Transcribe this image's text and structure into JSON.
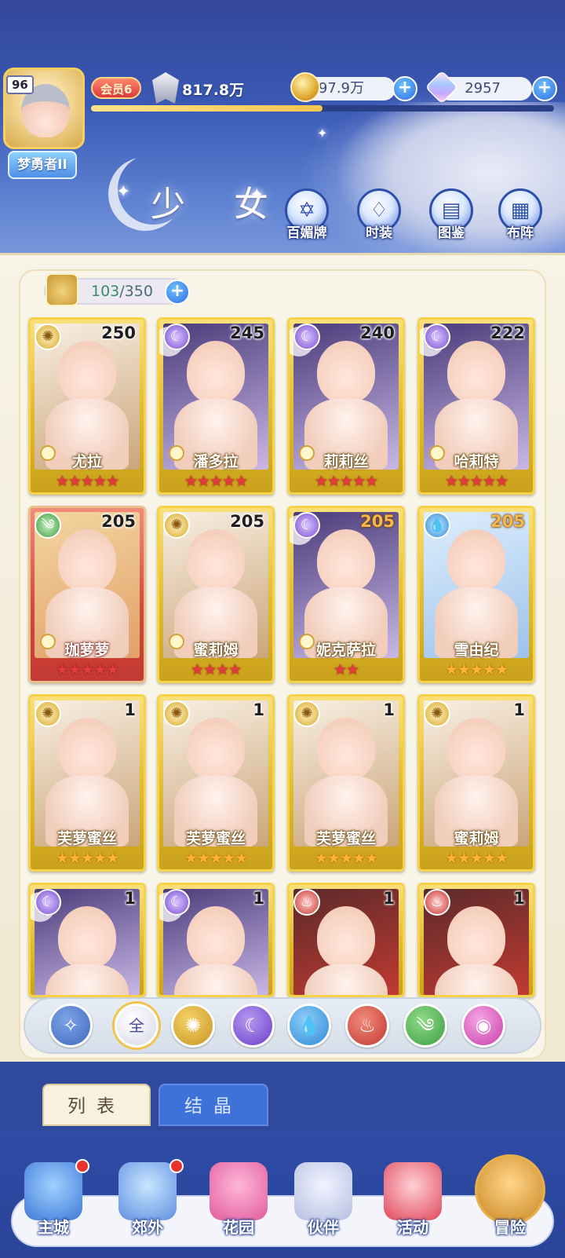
{
  "header": {
    "title": "少 女",
    "player_level": "96",
    "player_name": "梦勇者II",
    "vip": "会员6",
    "power": "817.8万",
    "exp_fraction": 0.5,
    "gold": "797.9万",
    "gems": "2957"
  },
  "top_buttons": [
    {
      "label": "百媚牌",
      "icon": "card-icon"
    },
    {
      "label": "时装",
      "icon": "costume-icon"
    },
    {
      "label": "图鉴",
      "icon": "book-icon"
    },
    {
      "label": "布阵",
      "icon": "grid-icon"
    }
  ],
  "inventory": {
    "current": "103",
    "max": "/350"
  },
  "cards": [
    {
      "name": "尤拉",
      "level": "250",
      "element": "light",
      "stars": 5,
      "star_color": "r"
    },
    {
      "name": "潘多拉",
      "level": "245",
      "element": "moon",
      "stars": 5,
      "star_color": "r"
    },
    {
      "name": "莉莉丝",
      "level": "240",
      "element": "moon",
      "stars": 5,
      "star_color": "r"
    },
    {
      "name": "哈莉特",
      "level": "222",
      "element": "moon",
      "stars": 5,
      "star_color": "r"
    },
    {
      "name": "珈萝萝",
      "level": "205",
      "element": "wind",
      "stars": 5,
      "star_color": "r"
    },
    {
      "name": "蜜莉姆",
      "level": "205",
      "element": "light",
      "stars": 4,
      "star_color": "r"
    },
    {
      "name": "妮克萨拉",
      "level": "205",
      "element": "moon",
      "stars": 2,
      "star_color": "r"
    },
    {
      "name": "雪由纪",
      "level": "205",
      "element": "water",
      "stars": 5,
      "star_color": "o"
    },
    {
      "name": "芙萝蜜丝",
      "level": "1",
      "element": "light",
      "stars": 5,
      "star_color": "o"
    },
    {
      "name": "芙萝蜜丝",
      "level": "1",
      "element": "light",
      "stars": 5,
      "star_color": "o"
    },
    {
      "name": "芙萝蜜丝",
      "level": "1",
      "element": "light",
      "stars": 5,
      "star_color": "o"
    },
    {
      "name": "蜜莉姆",
      "level": "1",
      "element": "light",
      "stars": 5,
      "star_color": "o"
    },
    {
      "name": "",
      "level": "1",
      "element": "moon",
      "stars": 0,
      "star_color": "o"
    },
    {
      "name": "",
      "level": "1",
      "element": "moon",
      "stars": 0,
      "star_color": "o"
    },
    {
      "name": "",
      "level": "1",
      "element": "fire",
      "stars": 0,
      "star_color": "o"
    },
    {
      "name": "",
      "level": "1",
      "element": "fire",
      "stars": 0,
      "star_color": "o"
    }
  ],
  "filters": [
    {
      "label": "",
      "icon": "collapse-icon"
    },
    {
      "label": "全",
      "icon": "all-icon"
    },
    {
      "label": "",
      "icon": "light-element-icon"
    },
    {
      "label": "",
      "icon": "moon-element-icon"
    },
    {
      "label": "",
      "icon": "water-element-icon"
    },
    {
      "label": "",
      "icon": "fire-element-icon"
    },
    {
      "label": "",
      "icon": "wind-element-icon"
    },
    {
      "label": "",
      "icon": "star-element-icon"
    }
  ],
  "view_tabs": {
    "list": "列表",
    "crystal": "结晶"
  },
  "nav": [
    {
      "label": "主城",
      "badge": true
    },
    {
      "label": "郊外",
      "badge": true
    },
    {
      "label": "花园",
      "badge": false
    },
    {
      "label": "伙伴",
      "badge": false
    },
    {
      "label": "活动",
      "badge": false
    },
    {
      "label": "冒险",
      "badge": false
    }
  ],
  "colors": {
    "accent": "#2f6fe0",
    "gold": "#f4d24a",
    "red_star": "#e53b3b",
    "orange_star": "#ffb23a"
  }
}
